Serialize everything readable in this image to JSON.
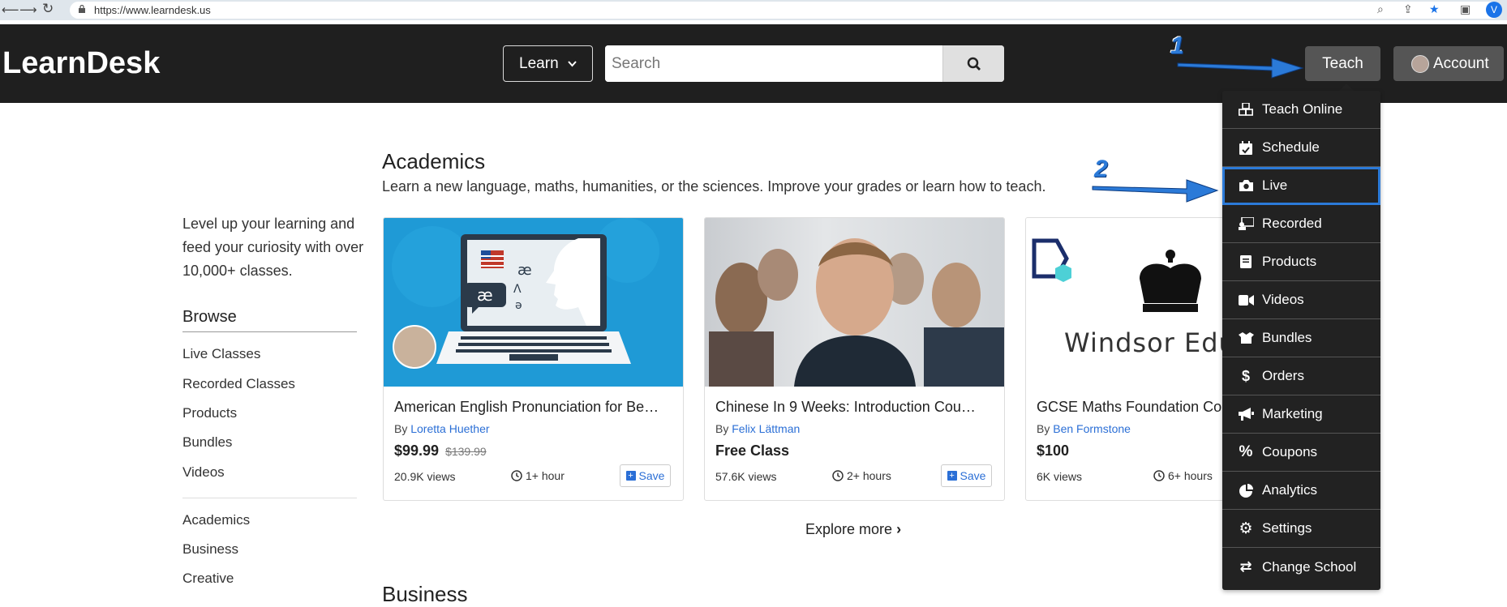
{
  "browser": {
    "url": "https://www.learndesk.us",
    "profile_initial": "V"
  },
  "header": {
    "logo": "LearnDesk",
    "learn_label": "Learn",
    "search_placeholder": "Search",
    "teach_label": "Teach",
    "account_label": "Account"
  },
  "sidebar": {
    "intro": "Level up your learning and feed your curiosity with over 10,000+ classes.",
    "browse_title": "Browse",
    "links": [
      "Live Classes",
      "Recorded Classes",
      "Products",
      "Bundles",
      "Videos"
    ],
    "categories": [
      "Academics",
      "Business",
      "Creative"
    ]
  },
  "main": {
    "section_title": "Academics",
    "section_desc": "Learn a new language, maths, humanities, or the sciences. Improve your grades or learn how to teach.",
    "next_section_title": "Business",
    "explore_label": "Explore more",
    "cards": [
      {
        "title": "American English Pronunciation for Be…",
        "by": "By",
        "teacher": "Loretta Huether",
        "price": "$99.99",
        "old_price": "$139.99",
        "views": "20.9K views",
        "duration": "1+ hour",
        "save": "Save"
      },
      {
        "title": "Chinese In 9 Weeks: Introduction Cou…",
        "by": "By",
        "teacher": "Felix Lättman",
        "price": "Free Class",
        "old_price": "",
        "views": "57.6K views",
        "duration": "2+ hours",
        "save": "Save"
      },
      {
        "title": "GCSE Maths Foundation Co",
        "by": "By",
        "teacher": "Ben Formstone",
        "price": "$100",
        "old_price": "",
        "views": "6K views",
        "duration": "6+ hours",
        "save": "",
        "image_text": "Windsor Educ"
      }
    ]
  },
  "teach_menu": {
    "items": [
      "Teach Online",
      "Schedule",
      "Live",
      "Recorded",
      "Products",
      "Videos",
      "Bundles",
      "Orders",
      "Marketing",
      "Coupons",
      "Analytics",
      "Settings",
      "Change School"
    ],
    "highlighted": "Live"
  },
  "annotations": {
    "step1": "1",
    "step2": "2"
  },
  "colors": {
    "header_bg": "#1f1f1f",
    "menu_bg": "#222222",
    "accent": "#2b7ad8",
    "link": "#2b6fd6"
  }
}
